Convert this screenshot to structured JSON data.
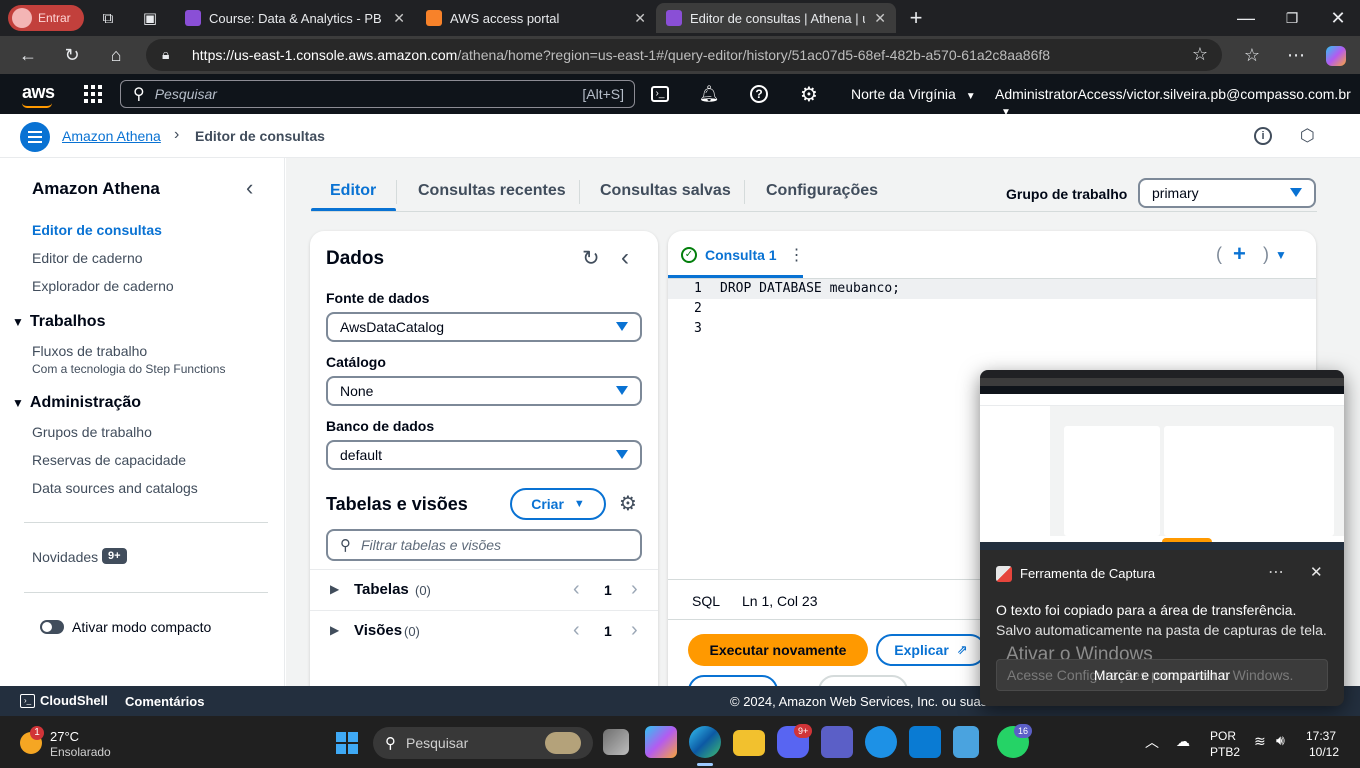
{
  "browser": {
    "profile_label": "Entrar",
    "tabs": [
      {
        "title": "Course: Data & Analytics - PB - AW"
      },
      {
        "title": "AWS access portal"
      },
      {
        "title": "Editor de consultas | Athena | us-ea"
      }
    ],
    "url_host": "https://us-east-1.console.aws.amazon.com",
    "url_path": "/athena/home?region=us-east-1#/query-editor/history/51ac07d5-68ef-482b-a570-61a2c8aa86f8"
  },
  "aws_header": {
    "logo": "aws",
    "search_placeholder": "Pesquisar",
    "search_shortcut": "[Alt+S]",
    "region": "Norte da Virgínia",
    "account": "AdministratorAccess/victor.silveira.pb@compasso.com.br"
  },
  "breadcrumb": {
    "service": "Amazon Athena",
    "page": "Editor de consultas"
  },
  "sidebar": {
    "title": "Amazon Athena",
    "links": [
      "Editor de consultas",
      "Editor de caderno",
      "Explorador de caderno"
    ],
    "sections": [
      {
        "title": "Trabalhos",
        "items": [
          {
            "label": "Fluxos de trabalho",
            "sub": "Com a tecnologia do Step Functions"
          }
        ]
      },
      {
        "title": "Administração",
        "items": [
          {
            "label": "Grupos de trabalho"
          },
          {
            "label": "Reservas de capacidade"
          },
          {
            "label": "Data sources and catalogs"
          }
        ]
      }
    ],
    "news_label": "Novidades",
    "news_badge": "9+",
    "compact_label": "Ativar modo compacto"
  },
  "main": {
    "tabs": [
      "Editor",
      "Consultas recentes",
      "Consultas salvas",
      "Configurações"
    ],
    "workgroup_label": "Grupo de trabalho",
    "workgroup_value": "primary"
  },
  "data_panel": {
    "title": "Dados",
    "source_label": "Fonte de dados",
    "source_value": "AwsDataCatalog",
    "catalog_label": "Catálogo",
    "catalog_value": "None",
    "db_label": "Banco de dados",
    "db_value": "default",
    "tables_title": "Tabelas e visões",
    "create_label": "Criar",
    "filter_placeholder": "Filtrar tabelas e visões",
    "rows": [
      {
        "label": "Tabelas",
        "count": "(0)",
        "page": "1"
      },
      {
        "label": "Visões",
        "count": "(0)",
        "page": "1"
      }
    ]
  },
  "editor": {
    "query_tab": "Consulta 1",
    "lines": [
      "DROP DATABASE meubanco;",
      "",
      ""
    ],
    "line_numbers": [
      "1",
      "2",
      "3"
    ],
    "language": "SQL",
    "cursor": "Ln 1, Col 23",
    "run_label": "Executar novamente",
    "explain_label": "Explicar"
  },
  "statusbar": {
    "cloudshell": "CloudShell",
    "comments": "Comentários",
    "copyright": "© 2024, Amazon Web Services, Inc. ou suas afi"
  },
  "toast": {
    "app": "Ferramenta de Captura",
    "line1": "O texto foi copiado para a área de transferência.",
    "line2": "Salvo automaticamente na pasta de capturas de tela.",
    "action": "Marcar e compartilhar",
    "watermark1": "Ativar o Windows",
    "watermark2": "Acesse Configurações para ativar o Windows."
  },
  "taskbar": {
    "temp": "27°C",
    "weather": "Ensolarado",
    "weather_badge": "1",
    "search": "Pesquisar",
    "lang1": "POR",
    "lang2": "PTB2",
    "time": "17:37",
    "date": "10/12",
    "discord_badge": "9+",
    "whatsapp_badge": "16"
  },
  "colors": {
    "aws_orange": "#ff9900",
    "aws_link": "#0972d3",
    "aws_dark": "#0f141a"
  }
}
